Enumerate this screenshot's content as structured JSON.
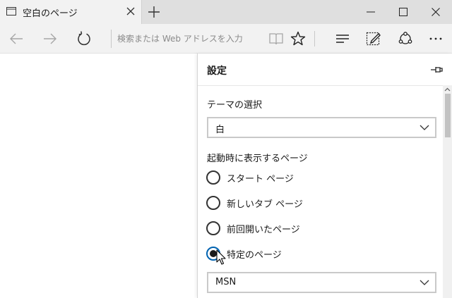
{
  "tab": {
    "title": "空白のページ",
    "icon": "page-icon",
    "close_icon": "close-icon"
  },
  "toolbar": {
    "address_placeholder": "検索または Web アドレスを入力",
    "icons": [
      "back-arrow-icon",
      "forward-arrow-icon",
      "refresh-icon",
      "reading-view-icon",
      "star-icon",
      "hub-icon",
      "web-note-icon",
      "share-icon",
      "more-icon"
    ]
  },
  "settings": {
    "title": "設定",
    "theme_label": "テーマの選択",
    "theme_value": "白",
    "startup_label": "起動時に表示するページ",
    "options": [
      {
        "label": "スタート ページ",
        "checked": false
      },
      {
        "label": "新しいタブ ページ",
        "checked": false
      },
      {
        "label": "前回開いたページ",
        "checked": false
      },
      {
        "label": "特定のページ",
        "checked": true
      }
    ],
    "specific_page_value": "MSN"
  },
  "colors": {
    "titlebar": "#dfdfdf",
    "toolbar": "#f2f2f2",
    "accent": "#0063b1"
  }
}
